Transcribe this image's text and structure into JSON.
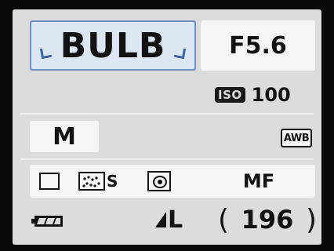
{
  "shutter": {
    "value": "BULB"
  },
  "aperture": {
    "value": "F5.6"
  },
  "iso": {
    "icon_label": "ISO",
    "value": "100"
  },
  "mode": {
    "value": "M"
  },
  "white_balance": {
    "value": "AWB"
  },
  "settings": {
    "drive_icon": "single-shot-icon",
    "picture_style_icon": "picture-style-icon",
    "picture_style_letter": "S",
    "metering_icon": "evaluative-metering-icon",
    "focus_mode": "MF"
  },
  "status": {
    "battery_icon": "battery-full-icon",
    "quality": "L",
    "shots_remaining": "196",
    "paren_open": "(",
    "paren_close": ")"
  },
  "colors": {
    "screen_bg": "#dcdcdc",
    "selected_bg": "#dde6f3",
    "selected_border": "#6d8fc2",
    "text": "#121212"
  }
}
